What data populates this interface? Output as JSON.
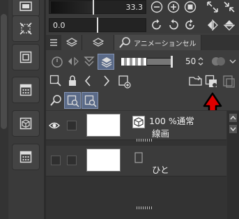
{
  "toolbar": {
    "value_top": "33.3",
    "value_mid": "0.0"
  },
  "panel": {
    "tabs": [
      {
        "label": ""
      },
      {
        "label": ""
      },
      {
        "label": "アニメーションセル"
      }
    ],
    "opacity": "50"
  },
  "layers": [
    {
      "mode": "100 %通常",
      "name": "線画",
      "selected": true,
      "visible": true
    },
    {
      "mode": "",
      "name": "ひと",
      "selected": false,
      "visible": false
    }
  ],
  "annotation": {
    "arrow_color": "#e00000"
  },
  "colors": {
    "selection": "#5a6a88",
    "background": "#3d3d3d"
  }
}
